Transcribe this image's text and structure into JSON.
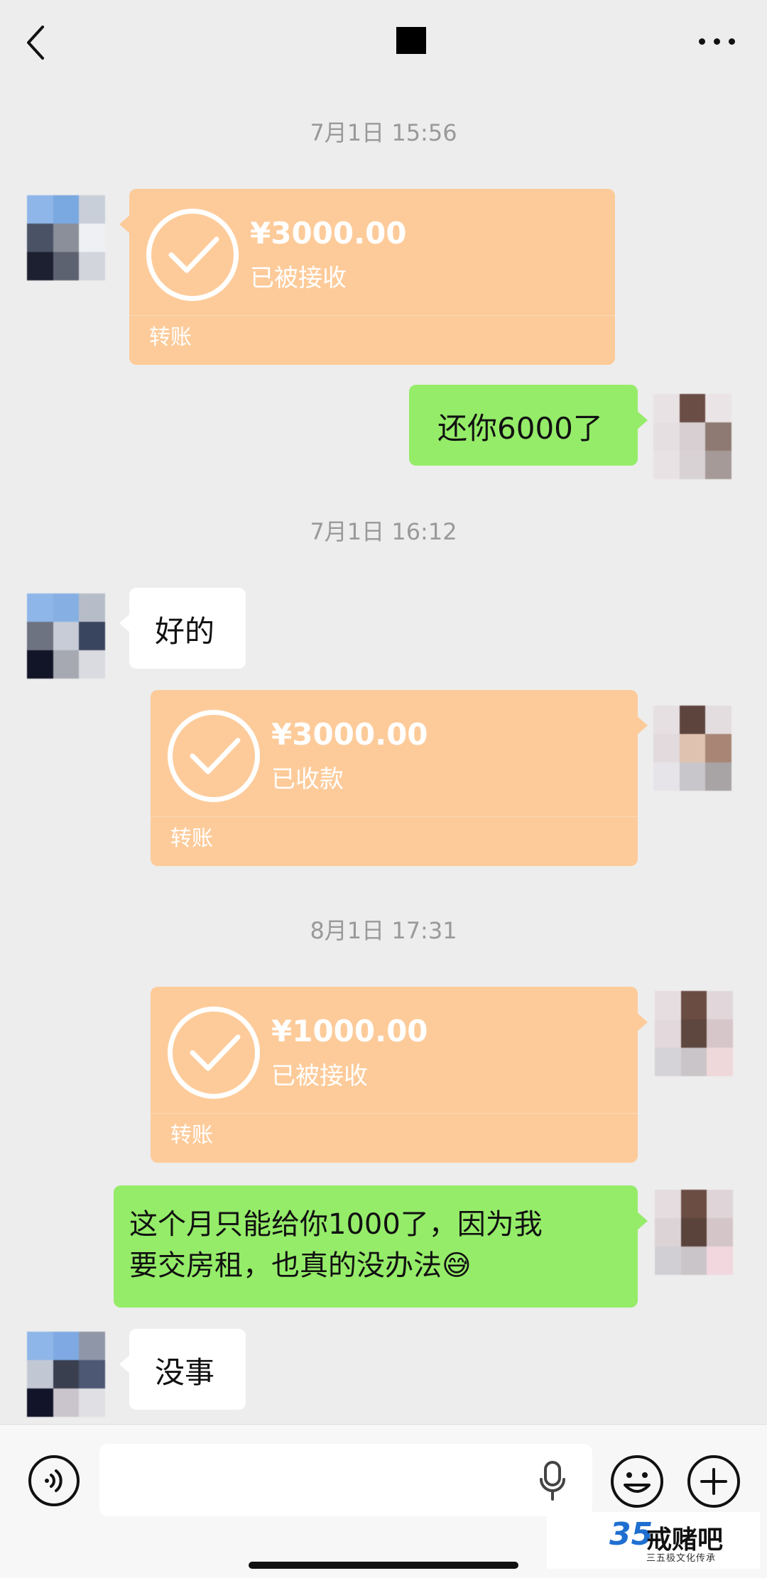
{
  "header": {
    "back_icon": "chevron-left-icon",
    "more_icon": "more-dots-icon"
  },
  "messages": [
    {
      "type": "timestamp",
      "text": "7月1日 15:56"
    },
    {
      "type": "transfer",
      "side": "left",
      "amount": "¥3000.00",
      "status": "已被接收",
      "label": "转账"
    },
    {
      "type": "text",
      "side": "right",
      "text": "还你6000了"
    },
    {
      "type": "timestamp",
      "text": "7月1日 16:12"
    },
    {
      "type": "text",
      "side": "left",
      "text": "好的"
    },
    {
      "type": "transfer",
      "side": "right",
      "amount": "¥3000.00",
      "status": "已收款",
      "label": "转账"
    },
    {
      "type": "timestamp",
      "text": "8月1日 17:31"
    },
    {
      "type": "transfer",
      "side": "right",
      "amount": "¥1000.00",
      "status": "已被接收",
      "label": "转账"
    },
    {
      "type": "text",
      "side": "right",
      "line1": "这个月只能给你1000了，因为我",
      "line2": "要交房租，也真的没办法",
      "emoji": "😅"
    },
    {
      "type": "text",
      "side": "left",
      "text": "没事"
    }
  ],
  "input_bar": {
    "voice_icon": "voice-icon",
    "input_value": "",
    "mic_icon": "mic-icon",
    "emoji_icon": "emoji-icon",
    "plus_icon": "plus-icon"
  },
  "watermark": {
    "number": "35",
    "brand": "戒赌吧",
    "subtitle": "三五极文化传承"
  },
  "colors": {
    "background": "#ededed",
    "transfer_bubble": "#fdcb9a",
    "sent_bubble": "#95ec69",
    "received_bubble": "#ffffff"
  }
}
